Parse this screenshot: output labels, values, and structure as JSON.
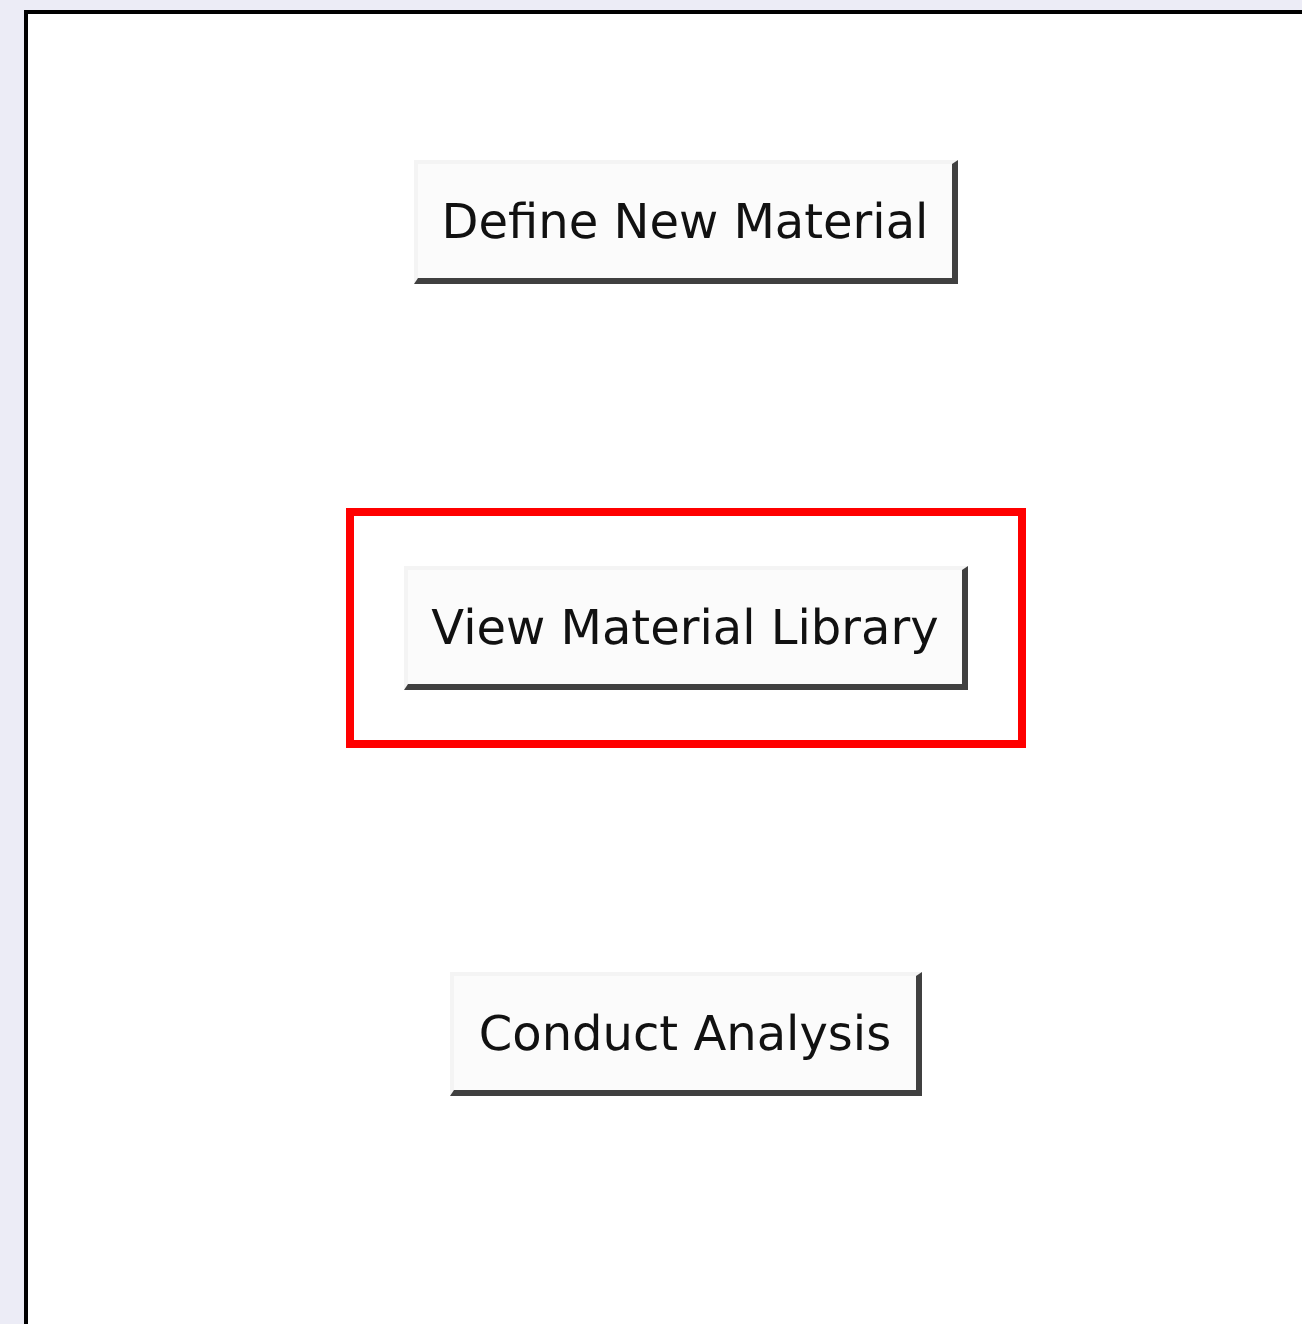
{
  "buttons": [
    {
      "label": "Define New Material",
      "highlighted": false
    },
    {
      "label": "View Material Library",
      "highlighted": true
    },
    {
      "label": "Conduct Analysis",
      "highlighted": false
    }
  ]
}
